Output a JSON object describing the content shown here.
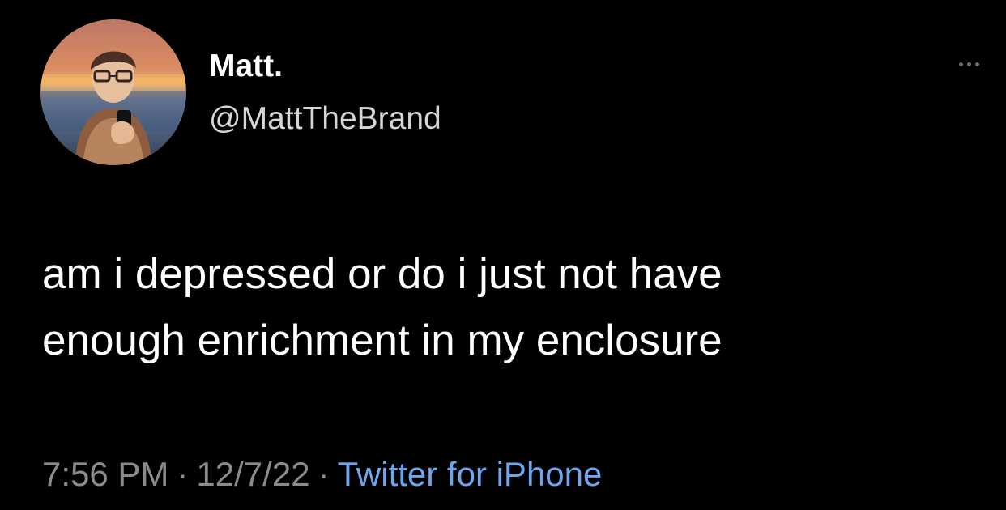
{
  "tweet": {
    "display_name": "Matt.",
    "handle": "@MattTheBrand",
    "text_lines": [
      "am i depressed or do i just not have",
      "enough enrichment in my enclosure"
    ],
    "meta": {
      "time": "7:56 PM",
      "separator": "·",
      "date": "12/7/22",
      "source": "Twitter for iPhone"
    },
    "more_icon": "more-horizontal-icon",
    "avatar_icon": "profile-photo"
  },
  "colors": {
    "background": "#000000",
    "text_primary": "#ffffff",
    "text_secondary": "#8b8b8b",
    "link": "#6ea5ef"
  }
}
